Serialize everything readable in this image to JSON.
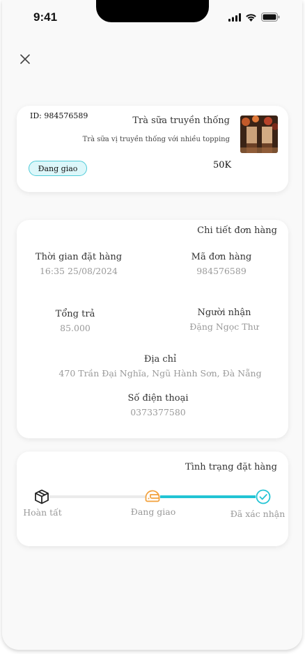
{
  "status_bar": {
    "time": "9:41"
  },
  "order": {
    "id_label": "ID: 984576589",
    "product_name": "Trà sữa truyền thống",
    "product_desc": "Trà sữa vị truyền thống với nhiều topping",
    "price": "50K",
    "status": "Đang giao"
  },
  "detail": {
    "title": "Chi tiết đơn hàng",
    "order_time_label": "Thời gian đặt hàng",
    "order_time_value": "16:35 25/08/2024",
    "order_code_label": "Mã đơn hàng",
    "order_code_value": "984576589",
    "total_label": "Tổng trả",
    "total_value": "85.000",
    "receiver_label": "Người nhận",
    "receiver_value": "Đặng Ngọc Thư",
    "address_label": "Địa chỉ",
    "address_value": "470 Trần Đại Nghĩa, Ngũ Hành Sơn, Đà Nẵng",
    "phone_label": "Số điện thoại",
    "phone_value": "0373377580"
  },
  "tracking": {
    "title": "Tình trạng đặt hàng",
    "steps": [
      {
        "label": "Hoàn tất",
        "icon": "box-icon",
        "state": "pending"
      },
      {
        "label": "Đang giao",
        "icon": "helmet-icon",
        "state": "current"
      },
      {
        "label": "Đã xác nhận",
        "icon": "check-circle-icon",
        "state": "done"
      }
    ]
  },
  "colors": {
    "accent": "#22c4d4",
    "current": "#f2a03a",
    "pill_bg": "#dcf7fa",
    "muted": "#9a9a9a"
  }
}
